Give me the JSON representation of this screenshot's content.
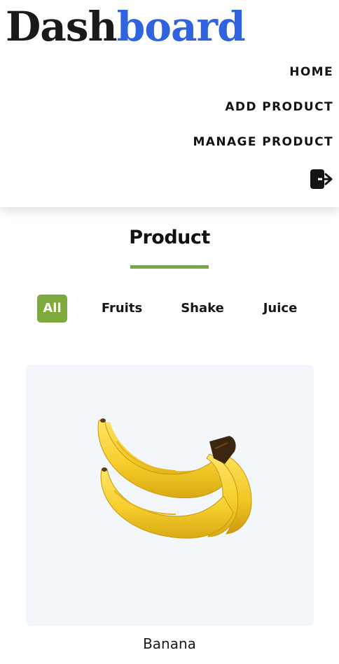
{
  "logo": {
    "part1": "Dash",
    "part2": "board"
  },
  "nav": {
    "home": "HOME",
    "add_product": "ADD PRODUCT",
    "manage_product": "MANAGE PRODUCT",
    "logout_icon": "logout-icon"
  },
  "section": {
    "title": "Product"
  },
  "filters": [
    "All",
    "Fruits",
    "Shake",
    "Juice"
  ],
  "active_filter": "All",
  "products": [
    {
      "name": "Banana",
      "image": "banana-image"
    }
  ],
  "colors": {
    "accent": "#7daa3c",
    "brand_blue": "#2f63e0",
    "card_bg": "#f3f6fb"
  }
}
